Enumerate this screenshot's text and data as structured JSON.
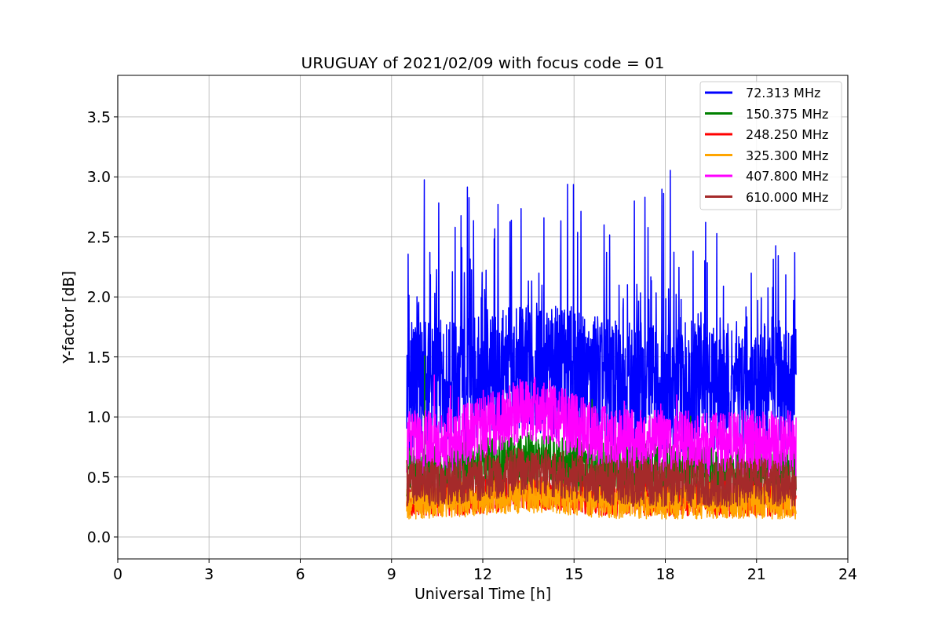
{
  "plot": {
    "title": "URUGUAY of 2021/02/09 with focus code = 01",
    "xlabel": "Universal Time [h]",
    "ylabel": "Y-factor [dB]",
    "xticks": [
      "0",
      "3",
      "6",
      "9",
      "12",
      "15",
      "18",
      "21",
      "24"
    ],
    "yticks": [
      "3.5",
      "3.0",
      "2.5",
      "2.0",
      "1.5",
      "1.0",
      "0.5",
      "0.0"
    ],
    "legend": [
      {
        "name": "72.313 MHz",
        "color": "#0000ff"
      },
      {
        "name": "150.375 MHz",
        "color": "#008000"
      },
      {
        "name": "248.250 MHz",
        "color": "#ff0000"
      },
      {
        "name": "325.300 MHz",
        "color": "#ffa500"
      },
      {
        "name": "407.800 MHz",
        "color": "#ff00ff"
      },
      {
        "name": "610.000 MHz",
        "color": "#a52a2a"
      }
    ]
  }
}
